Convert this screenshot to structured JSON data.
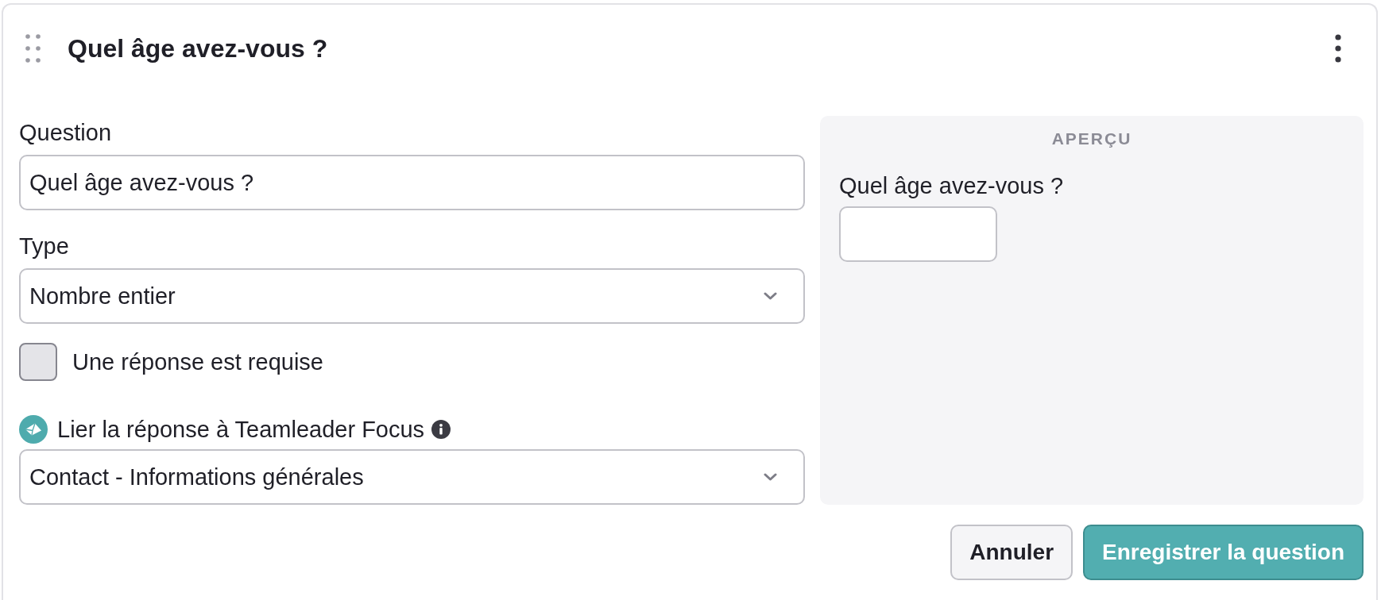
{
  "header": {
    "title": "Quel âge avez-vous ?"
  },
  "form": [
    {
      "kind": "text",
      "label": "Question",
      "value": "Quel âge avez-vous ?"
    },
    {
      "kind": "select",
      "label": "Type",
      "value": "Nombre entier"
    },
    {
      "kind": "checkbox",
      "label": "Une réponse est requise",
      "checked": false
    },
    {
      "kind": "linked-select",
      "label": "Lier la réponse à Teamleader Focus",
      "value": "Contact - Informations générales"
    }
  ],
  "preview": {
    "heading": "APERÇU",
    "question": "Quel âge avez-vous ?"
  },
  "buttons": [
    {
      "kind": "secondary",
      "label": "Annuler"
    },
    {
      "kind": "primary",
      "label": "Enregistrer la question"
    }
  ]
}
